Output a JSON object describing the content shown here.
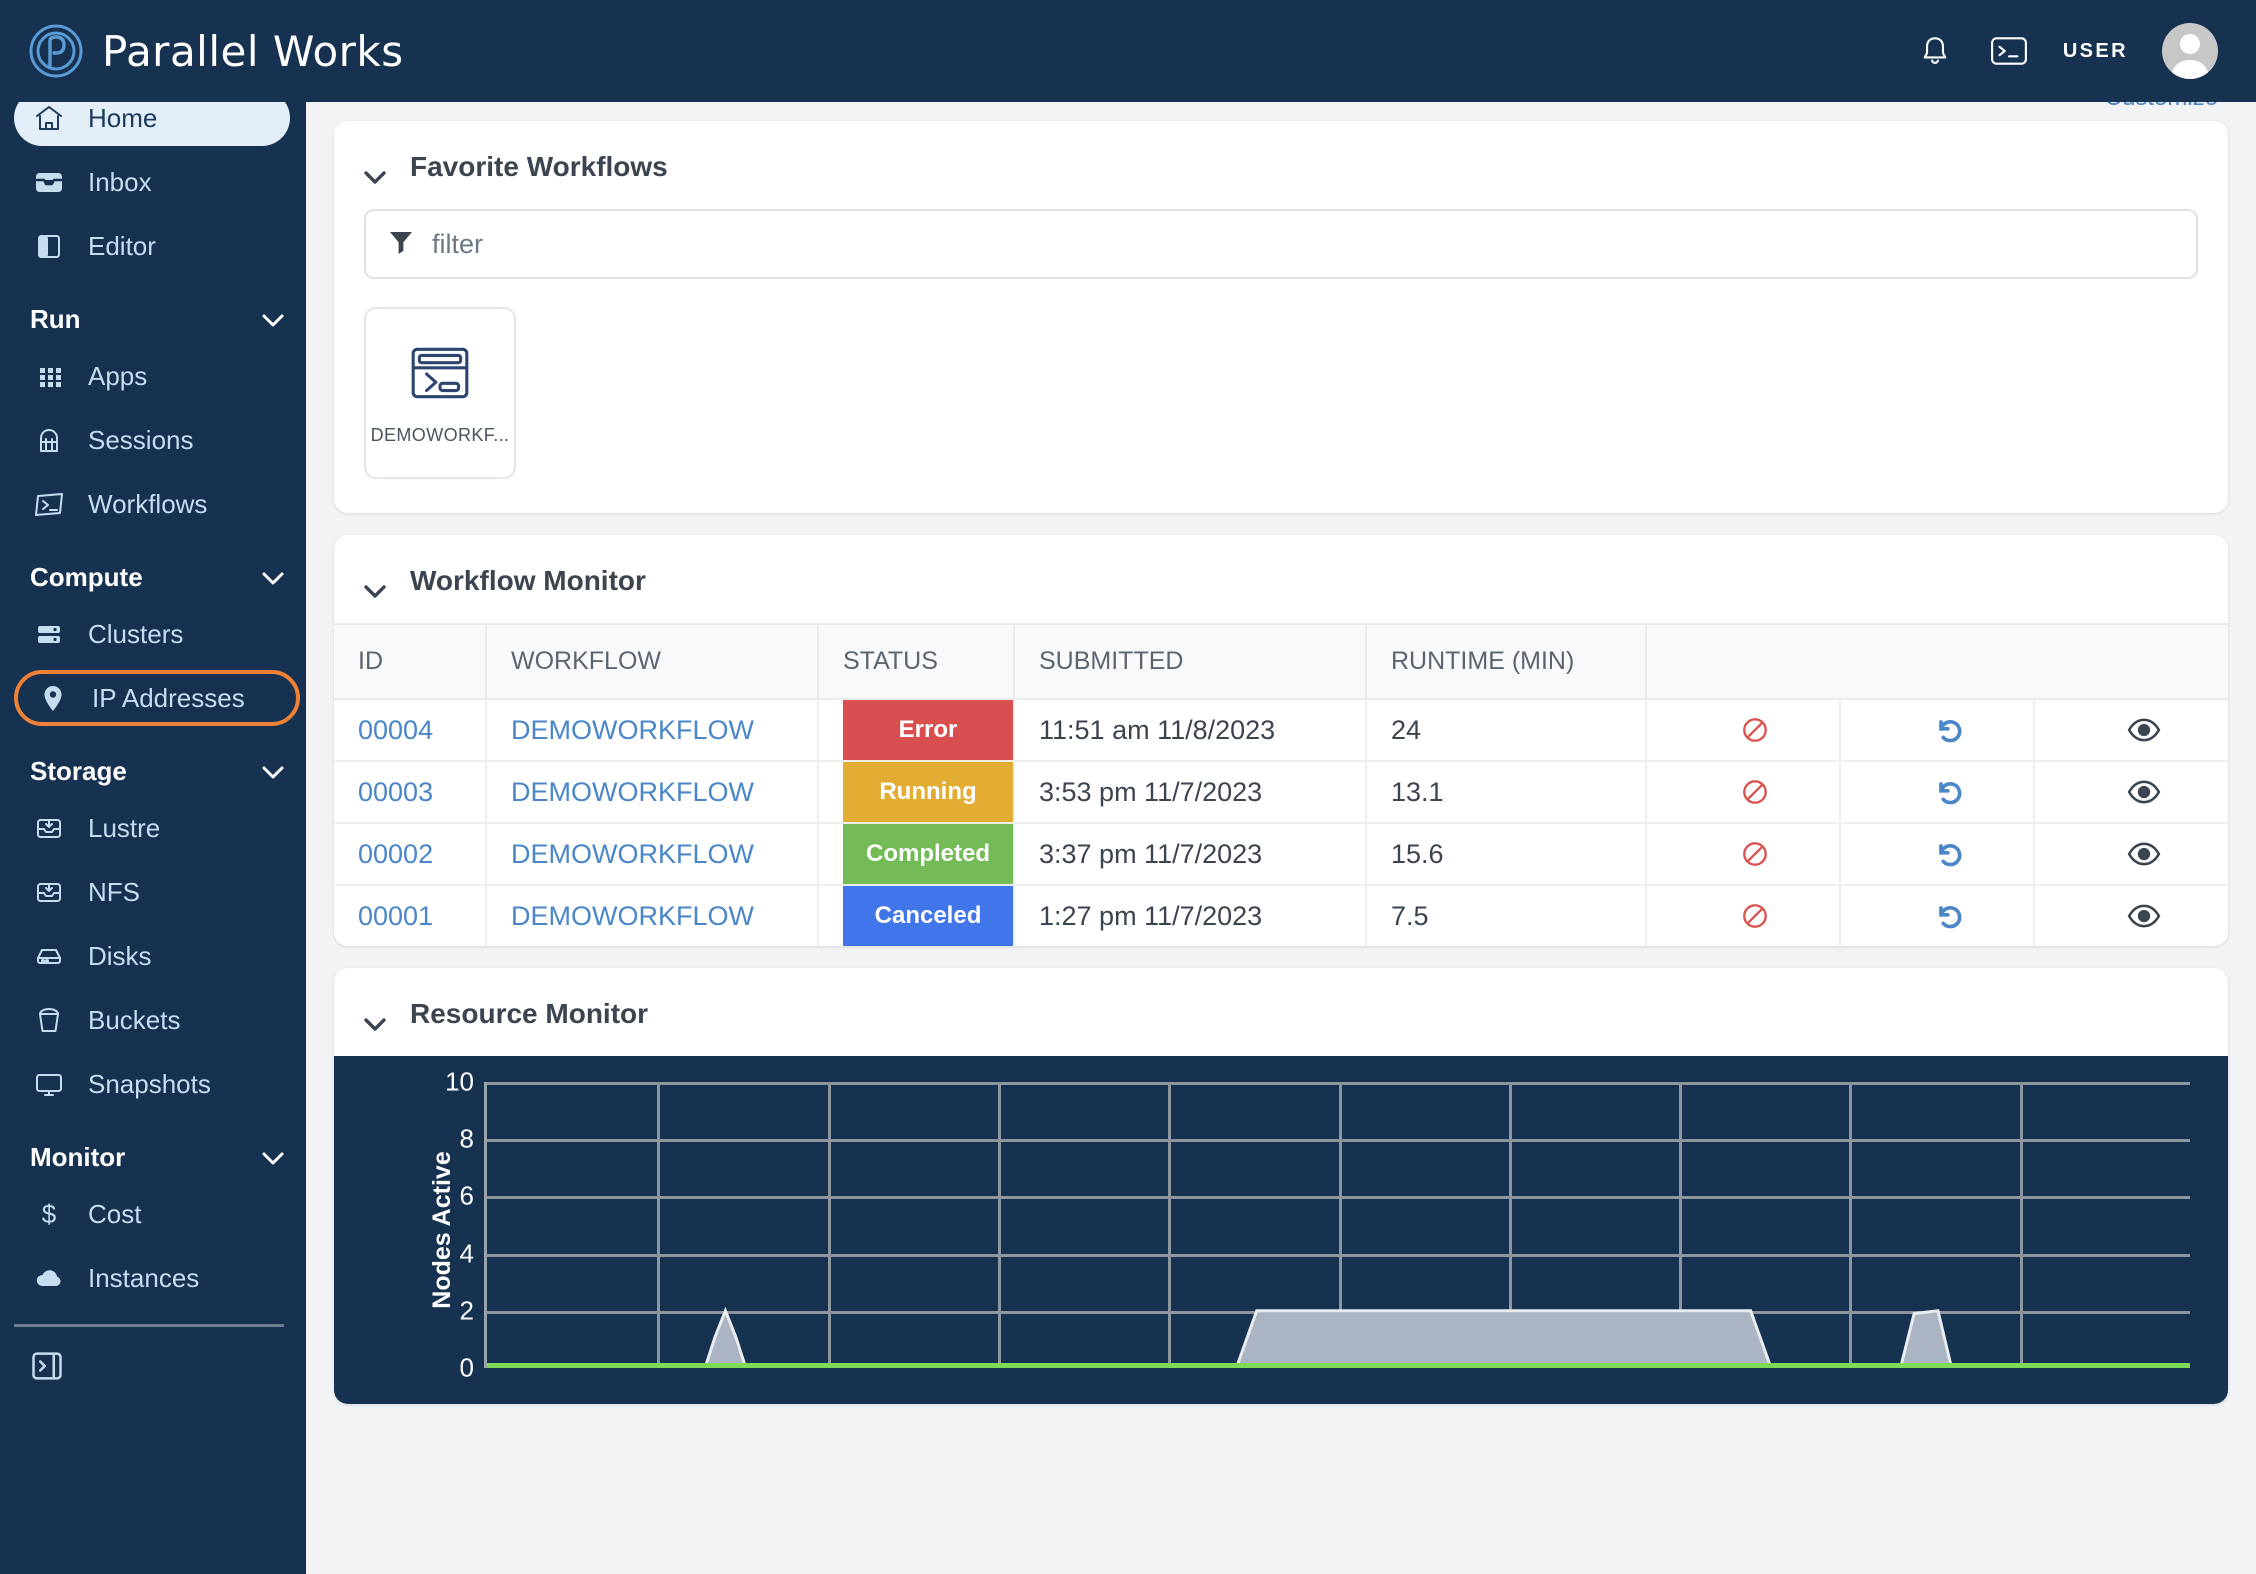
{
  "header": {
    "brand": "Parallel Works",
    "logo_icon": "parallel-works-logo-icon",
    "notifications_icon": "bell-icon",
    "terminal_icon": "terminal-icon",
    "user_label": "USER",
    "avatar_icon": "user-avatar-icon"
  },
  "sidebar": {
    "items": [
      {
        "label": "Home",
        "icon": "home-icon",
        "state": "active"
      },
      {
        "label": "Inbox",
        "icon": "inbox-icon",
        "state": "normal"
      },
      {
        "label": "Editor",
        "icon": "editor-icon",
        "state": "normal"
      }
    ],
    "groups": [
      {
        "title": "Run",
        "caret_icon": "chevron-down-icon",
        "items": [
          {
            "label": "Apps",
            "icon": "apps-grid-icon",
            "state": "normal"
          },
          {
            "label": "Sessions",
            "icon": "sessions-icon",
            "state": "normal"
          },
          {
            "label": "Workflows",
            "icon": "workflows-icon",
            "state": "normal"
          }
        ]
      },
      {
        "title": "Compute",
        "caret_icon": "chevron-down-icon",
        "items": [
          {
            "label": "Clusters",
            "icon": "server-icon",
            "state": "normal"
          },
          {
            "label": "IP Addresses",
            "icon": "map-pin-icon",
            "state": "highlight"
          }
        ]
      },
      {
        "title": "Storage",
        "caret_icon": "chevron-down-icon",
        "items": [
          {
            "label": "Lustre",
            "icon": "file-tray-icon",
            "state": "normal"
          },
          {
            "label": "NFS",
            "icon": "file-tray-icon",
            "state": "normal"
          },
          {
            "label": "Disks",
            "icon": "disk-icon",
            "state": "normal"
          },
          {
            "label": "Buckets",
            "icon": "bucket-icon",
            "state": "normal"
          },
          {
            "label": "Snapshots",
            "icon": "monitor-icon",
            "state": "normal"
          }
        ]
      },
      {
        "title": "Monitor",
        "caret_icon": "chevron-down-icon",
        "items": [
          {
            "label": "Cost",
            "icon": "dollar-icon",
            "state": "normal"
          },
          {
            "label": "Instances",
            "icon": "cloud-icon",
            "state": "normal"
          }
        ]
      }
    ],
    "collapse_icon": "sidebar-collapse-icon",
    "highlight_color": "#ef8236"
  },
  "main": {
    "customize": {
      "label": "Customize",
      "icon": "gear-icon",
      "color": "#4a86c8"
    },
    "favorite_workflows": {
      "title": "Favorite Workflows",
      "collapse_icon": "chevron-down-icon",
      "filter": {
        "placeholder": "filter",
        "value": "",
        "icon": "funnel-icon"
      },
      "tiles": [
        {
          "label": "DEMOWORKF...",
          "icon": "workflow-terminal-icon"
        }
      ]
    },
    "workflow_monitor": {
      "title": "Workflow Monitor",
      "collapse_icon": "chevron-down-icon",
      "columns": [
        "ID",
        "WORKFLOW",
        "STATUS",
        "SUBMITTED",
        "RUNTIME (MIN)",
        ""
      ],
      "rows": [
        {
          "id": "00004",
          "workflow": "DEMOWORKFLOW",
          "status": "Error",
          "status_color": "#d94f4f",
          "submitted": "11:51 am 11/8/2023",
          "runtime": "24"
        },
        {
          "id": "00003",
          "workflow": "DEMOWORKFLOW",
          "status": "Running",
          "status_color": "#e2ad32",
          "submitted": "3:53 pm 11/7/2023",
          "runtime": "13.1"
        },
        {
          "id": "00002",
          "workflow": "DEMOWORKFLOW",
          "status": "Completed",
          "status_color": "#73bb56",
          "submitted": "3:37 pm 11/7/2023",
          "runtime": "15.6"
        },
        {
          "id": "00001",
          "workflow": "DEMOWORKFLOW",
          "status": "Canceled",
          "status_color": "#4175ea",
          "submitted": "1:27 pm 11/7/2023",
          "runtime": "7.5"
        }
      ],
      "actions": [
        {
          "icon": "cancel-icon",
          "color": "#d9534f"
        },
        {
          "icon": "restart-icon",
          "color": "#4a86c8"
        },
        {
          "icon": "eye-icon",
          "color": "#3c4450"
        }
      ]
    },
    "resource_monitor": {
      "title": "Resource Monitor",
      "collapse_icon": "chevron-down-icon"
    }
  },
  "chart_data": {
    "type": "area",
    "title": "Resource Monitor",
    "xlabel": "",
    "ylabel": "Nodes Active",
    "ylim": [
      0,
      10
    ],
    "yticks": [
      0,
      2,
      4,
      6,
      8,
      10
    ],
    "grid": true,
    "x_gridline_count": 9,
    "background": "#173250",
    "series": [
      {
        "name": "Nodes Active",
        "fill_color": "#aab4c2",
        "line_color": "#e8ecf1",
        "baseline_color": "#7ed957",
        "x": [
          0,
          0.128,
          0.134,
          0.14,
          0.146,
          0.152,
          0.44,
          0.452,
          0.742,
          0.754,
          0.83,
          0.838,
          0.852,
          0.86,
          1.0
        ],
        "values": [
          0,
          0,
          0.55,
          1.0,
          0.55,
          0,
          0,
          1.0,
          1.0,
          0,
          0,
          0.95,
          1.0,
          0,
          0
        ]
      }
    ]
  }
}
